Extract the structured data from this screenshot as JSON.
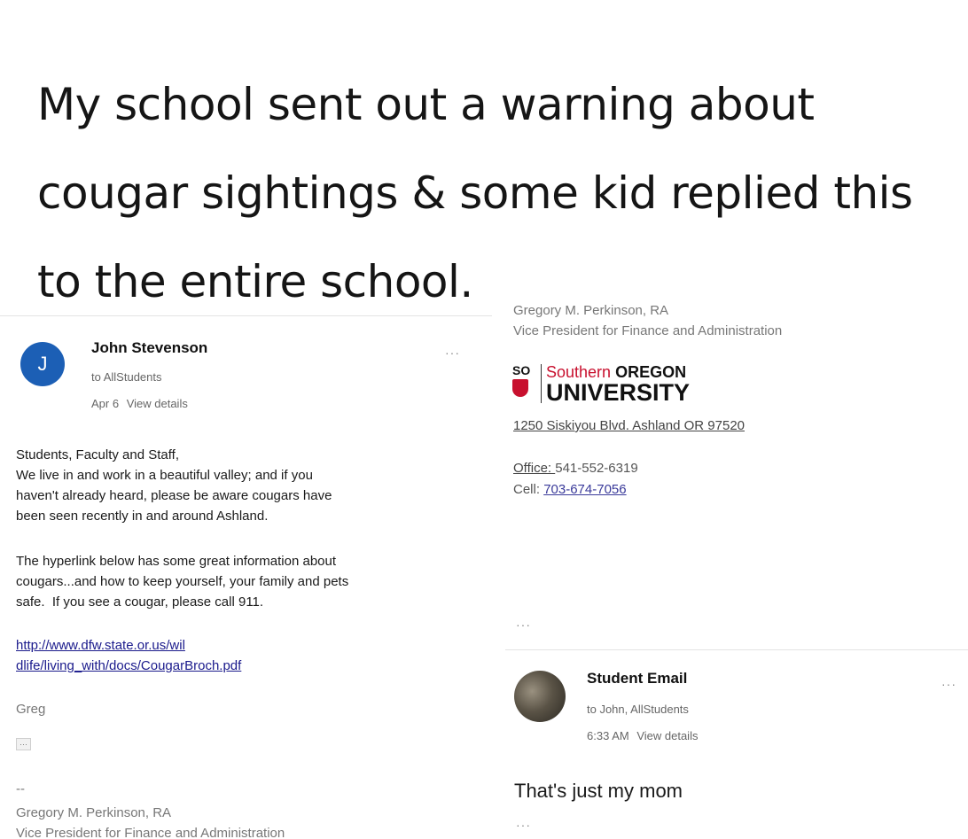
{
  "headline": "My school sent out a warning about cougar sightings & some kid replied this to the entire school.",
  "left_email": {
    "avatar_letter": "J",
    "sender": "John Stevenson",
    "to": "to AllStudents",
    "date": "Apr 6",
    "view_details": "View details",
    "more": "···",
    "body": [
      "Students, Faculty and Staff,",
      "We live in and work in a beautiful valley; and if you",
      "haven't already heard, please be aware cougars have",
      "been seen recently in and around Ashland."
    ],
    "body2": [
      "The hyperlink below has some great information about",
      "cougars...and how to keep yourself, your family and pets",
      "safe.  If you see a cougar, please call 911."
    ],
    "link_lines": [
      "http://www.dfw.state.or.us/wil",
      "dlife/living_with/docs/CougarBroch.pdf"
    ],
    "signoff": "Greg",
    "trimmed": "···",
    "sig_dash": "--",
    "sig_name": "Gregory M. Perkinson, RA",
    "sig_title": "Vice President for Finance and Administration"
  },
  "right_signature": {
    "name": "Gregory M. Perkinson, RA",
    "title": "Vice President for Finance and Administration",
    "logo_so": "SO",
    "logo_southern": "Southern",
    "logo_oregon": "OREGON",
    "logo_university": "UNIVERSITY",
    "address": "1250 Siskiyou Blvd. Ashland  OR 97520",
    "office_label": "Office: ",
    "office_number": "541-552-6319",
    "cell_label": "Cell: ",
    "cell_number": "703-674-7056",
    "more": "···"
  },
  "reply_email": {
    "sender": "Student Email",
    "to": "to John, AllStudents",
    "time": "6:33 AM",
    "view_details": "View details",
    "more": "···",
    "body": "That's just my mom",
    "trimmed": "···"
  },
  "colors": {
    "avatar_blue": "#1c5fb5",
    "logo_red": "#c8102e",
    "link": "#1a1a8c"
  }
}
